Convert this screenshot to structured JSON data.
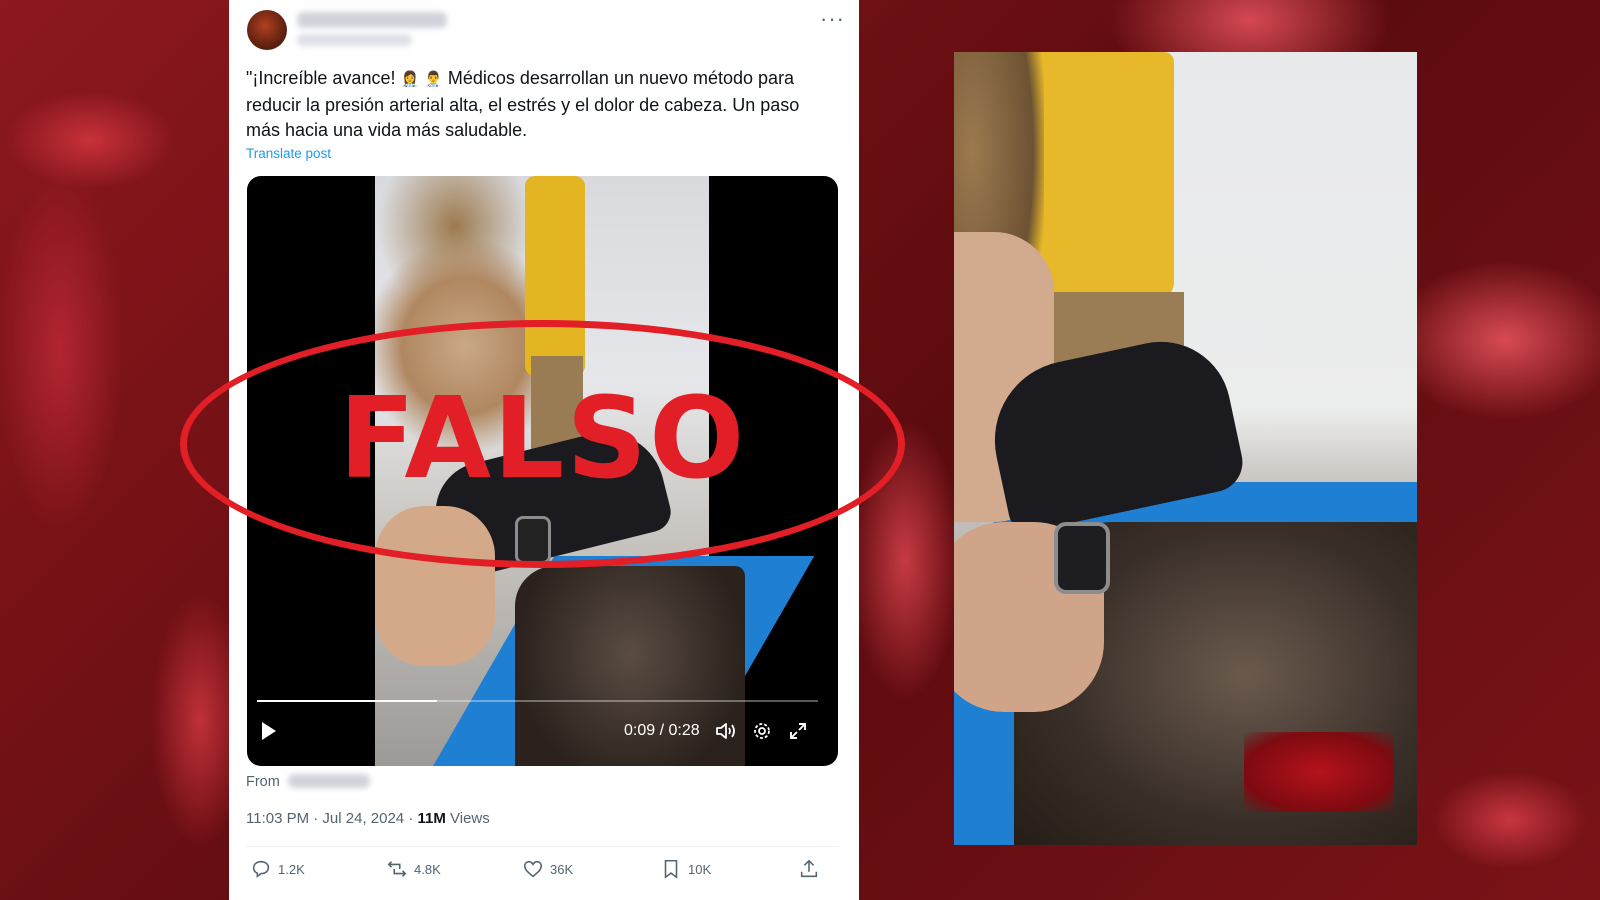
{
  "tweet": {
    "author_name": "",
    "author_handle": "",
    "more_icon": "more-horizontal-icon",
    "text_before_emoji": "\"¡Increíble avance! ",
    "emoji": [
      "👩‍⚕️",
      "👨‍⚕️"
    ],
    "text_after_emoji": " Médicos desarrollan un nuevo método para reducir la presión arterial alta, el estrés y el dolor de cabeza. Un paso más hacia una vida más saludable.",
    "translate_label": "Translate post",
    "video": {
      "current_time": "0:09",
      "duration": "0:28",
      "time_display": "0:09 / 0:28",
      "progress": 0.32
    },
    "from_label": "From",
    "timestamp": "11:03 PM · Jul 24, 2024 · ",
    "views_count": "11M",
    "views_label": " Views",
    "actions": {
      "replies": "1.2K",
      "reposts": "4.8K",
      "likes": "36K",
      "bookmarks": "10K"
    }
  },
  "stamp": {
    "label": "FALSO",
    "color": "#e21e26"
  },
  "colors": {
    "link": "#1d9bf0",
    "background": "#6e0f12"
  }
}
